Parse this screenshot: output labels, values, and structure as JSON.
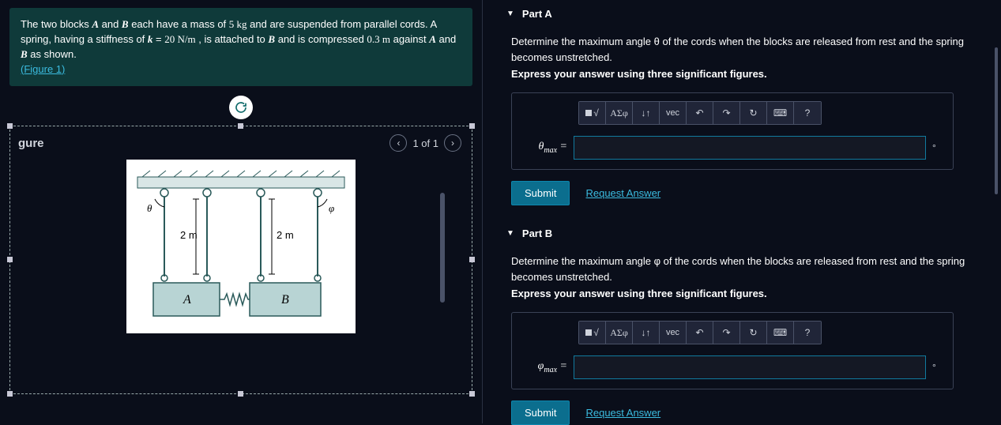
{
  "problem": {
    "text_parts": {
      "p1": "The two blocks ",
      "A": "A",
      "p2": " and ",
      "B": "B",
      "p3": " each have a mass of ",
      "mass": "5 kg",
      "p4": " and are suspended from parallel cords. A spring, having a stiffness of ",
      "kvar": "k",
      "eq": " = ",
      "kval": "20  N/m",
      "p5": " , is attached to ",
      "p6": " and is compressed ",
      "comp": "0.3 m",
      "p7": " against ",
      "p8": " and ",
      "p9": " as shown. "
    },
    "figure_link": "(Figure 1)"
  },
  "figure": {
    "label": "gure",
    "counter": "1 of 1",
    "cord_len": "2 m",
    "block_A": "A",
    "block_B": "B",
    "theta": "θ",
    "phi": "φ"
  },
  "parts": [
    {
      "title": "Part A",
      "prompt": "Determine the maximum angle θ of the cords when the blocks are released from rest and the spring becomes unstretched.",
      "sub": "Express your answer using three significant figures.",
      "var_html": "θ",
      "var_sub": "max",
      "unit": "°",
      "value": "",
      "submit": "Submit",
      "request": "Request Answer"
    },
    {
      "title": "Part B",
      "prompt": "Determine the maximum angle φ of the cords when the blocks are released from rest and the spring becomes unstretched.",
      "sub": "Express your answer using three significant figures.",
      "var_html": "φ",
      "var_sub": "max",
      "unit": "°",
      "value": "",
      "submit": "Submit",
      "request": "Request Answer"
    }
  ],
  "toolbar": {
    "templates": "▭",
    "frac": "√",
    "greek": "ΑΣφ",
    "subsup": "↓↑",
    "vec": "vec",
    "undo": "↶",
    "redo": "↷",
    "reset": "↻",
    "keyboard": "⌨",
    "help": "?"
  }
}
